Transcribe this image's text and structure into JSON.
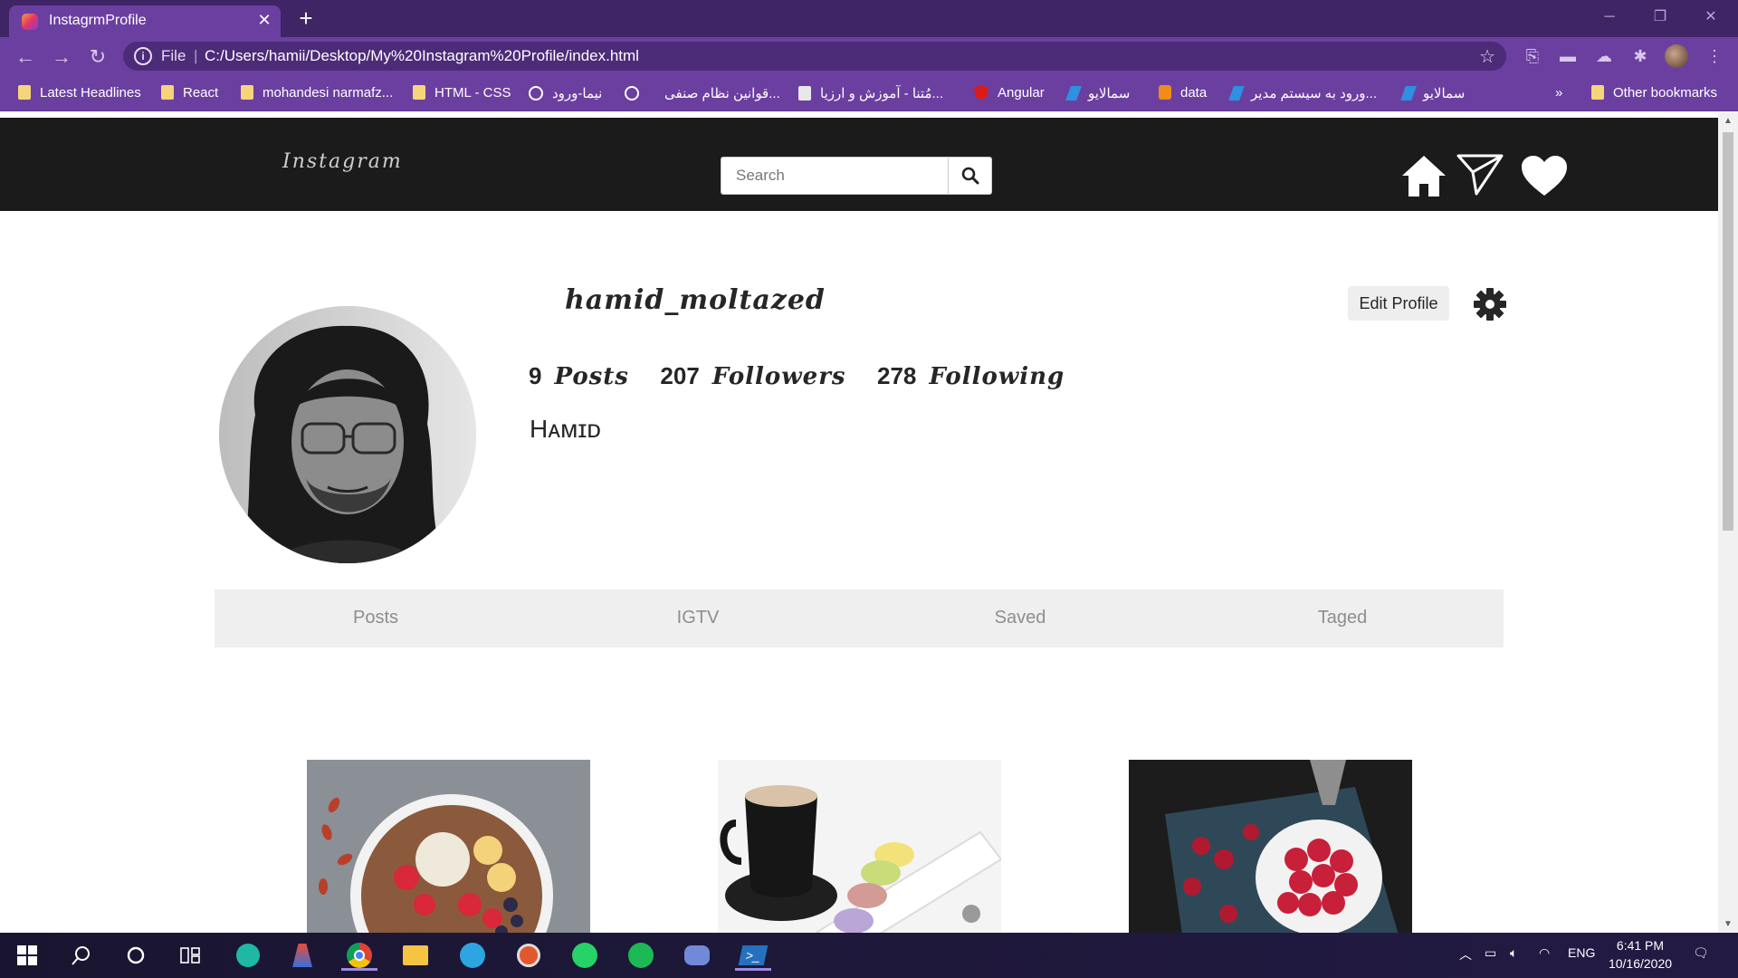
{
  "browser": {
    "tab_title": "InstagrmProfile",
    "url_scheme": "File",
    "url": "C:/Users/hamii/Desktop/My%20Instagram%20Profile/index.html",
    "accent_color": "#6b3fa0",
    "bookmarks": [
      {
        "label": "Latest Headlines",
        "icon": "folder-icon"
      },
      {
        "label": "React",
        "icon": "folder-icon"
      },
      {
        "label": "mohandesi narmafz...",
        "icon": "folder-icon"
      },
      {
        "label": "HTML - CSS",
        "icon": "folder-icon"
      },
      {
        "label": "نیما-ورود",
        "icon": "globe-icon"
      },
      {
        "label": "قوانین نظام صنفی...",
        "icon": "globe-icon"
      },
      {
        "label": "مُتنا - آموزش و ارزیا...",
        "icon": "site-icon"
      },
      {
        "label": "Angular",
        "icon": "angular-icon"
      },
      {
        "label": "سمالایو",
        "icon": "samalive-icon"
      },
      {
        "label": "data",
        "icon": "data-icon"
      },
      {
        "label": "ورود به سیستم مدیر...",
        "icon": "samalive-icon"
      },
      {
        "label": "سمالایو",
        "icon": "samalive-icon"
      }
    ],
    "overflow_label": "»",
    "other_bookmarks": "Other bookmarks"
  },
  "navbar": {
    "logo": "Instagram",
    "search_placeholder": "Search",
    "icons": [
      "home-icon",
      "send-icon",
      "heart-icon"
    ]
  },
  "profile": {
    "username": "hamid_moltazed",
    "edit_button": "Edit Profile",
    "settings_icon": "gear-icon",
    "stats": [
      {
        "count": "9",
        "label": "Posts"
      },
      {
        "count": "207",
        "label": "Followers"
      },
      {
        "count": "278",
        "label": "Following"
      }
    ],
    "bio": "Hᴀᴍɪᴅ"
  },
  "profile_tabs": [
    "Posts",
    "IGTV",
    "Saved",
    "Taged"
  ],
  "posts": [
    {
      "name": "post-smoothie-bowl"
    },
    {
      "name": "post-coffee-macarons"
    },
    {
      "name": "post-raspberries"
    }
  ],
  "taskbar": {
    "language": "ENG",
    "time": "6:41 PM",
    "date": "10/16/2020"
  }
}
